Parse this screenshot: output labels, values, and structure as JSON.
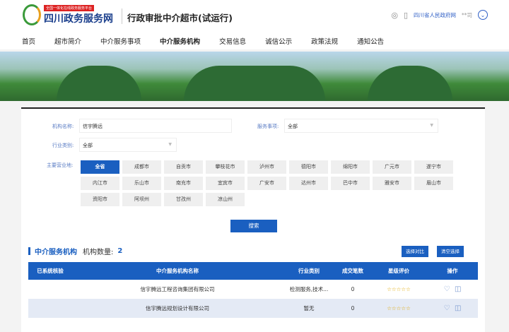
{
  "header": {
    "platform_tag": "全国一体化在线政务服务平台",
    "site_name": "四川政务服务网",
    "title": "行政审批中介超市(试运行)",
    "gov_link": "四川省人民政府网",
    "extra": "**司"
  },
  "nav": [
    "首页",
    "超市简介",
    "中介服务事项",
    "中介服务机构",
    "交易信息",
    "诚信公示",
    "政策法规",
    "通知公告"
  ],
  "form": {
    "name_label": "机构名称:",
    "name_value": "信宇腾远",
    "service_label": "服务事项:",
    "service_value": "全部",
    "industry_label": "行业类别:",
    "industry_value": "全部",
    "region_label": "主要营业地:",
    "regions": [
      "全省",
      "成都市",
      "自贡市",
      "攀枝花市",
      "泸州市",
      "德阳市",
      "绵阳市",
      "广元市",
      "遂宁市",
      "内江市",
      "乐山市",
      "南充市",
      "宜宾市",
      "广安市",
      "达州市",
      "巴中市",
      "雅安市",
      "眉山市",
      "资阳市",
      "阿坝州",
      "甘孜州",
      "凉山州"
    ],
    "search": "搜索"
  },
  "results": {
    "title": "中介服务机构",
    "count_label": "机构数量:",
    "count": "2",
    "compare": "选择对比",
    "clear": "清空选择",
    "headers": [
      "已系统核验",
      "中介服务机构名称",
      "行业类别",
      "成交笔数",
      "星级评价",
      "操作"
    ],
    "rows": [
      {
        "name": "信宇腾远工程咨询集团有限公司",
        "industry": "检测服务,技术...",
        "deals": "0",
        "stars": "☆☆☆☆☆"
      },
      {
        "name": "信宇腾远规划设计有限公司",
        "industry": "暂无",
        "deals": "0",
        "stars": "☆☆☆☆☆"
      }
    ]
  }
}
